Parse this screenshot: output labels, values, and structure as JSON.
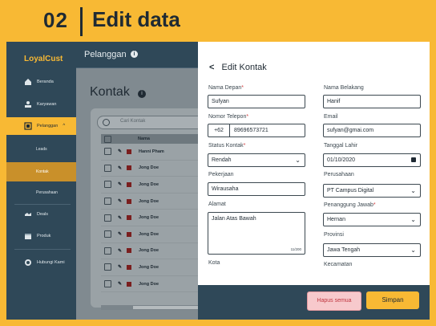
{
  "header": {
    "number": "02",
    "title": "Edit data"
  },
  "sidebar": {
    "logo": "LoyalCust",
    "items": [
      {
        "label": "Beranda"
      },
      {
        "label": "Karyawan"
      },
      {
        "label": "Pelanggan"
      },
      {
        "label": "Leads"
      },
      {
        "label": "Kontak"
      },
      {
        "label": "Perusahaan"
      },
      {
        "label": "Deals"
      },
      {
        "label": "Produk"
      },
      {
        "label": "Hubungi Kami"
      }
    ]
  },
  "page": {
    "breadcrumb": "Pelanggan",
    "title": "Kontak",
    "search_placeholder": "Cari Kontak",
    "table": {
      "header": "Nama",
      "rows": [
        "Hanni Pham",
        "Jong Doe",
        "Jong Doe",
        "Jong Doe",
        "Jong Doe",
        "Jong Doe",
        "Jong Doe",
        "Jong Doe",
        "Jong Doe"
      ]
    }
  },
  "drawer": {
    "title": "Edit Kontak",
    "fields": {
      "nama_depan": {
        "label": "Nama Depan",
        "value": "Sufyan"
      },
      "nama_belakang": {
        "label": "Nama Belakang",
        "value": "Hanif"
      },
      "nomor_telepon": {
        "label": "Nomor Telepon",
        "prefix": "+62",
        "value": "89696573721"
      },
      "email": {
        "label": "Email",
        "value": "sufyan@gmai.com"
      },
      "status_kontak": {
        "label": "Status Kontak",
        "value": "Rendah"
      },
      "tanggal_lahir": {
        "label": "Tanggal Lahir",
        "value": "01/10/2020"
      },
      "pekerjaan": {
        "label": "Pekerjaan",
        "value": "Wirausaha"
      },
      "perusahaan": {
        "label": "Perusahaan",
        "value": "PT Campus Digital"
      },
      "alamat": {
        "label": "Alamat",
        "value": "Jalan Atas Bawah",
        "counter": "11/200"
      },
      "penanggung_jawab": {
        "label": "Penanggung Jawab",
        "value": "Hernan"
      },
      "provinsi": {
        "label": "Provinsi",
        "value": "Jawa Tengah"
      },
      "kota": {
        "label": "Kota"
      },
      "kecamatan": {
        "label": "Kecamatan"
      }
    },
    "buttons": {
      "reset": "Hapus semua",
      "save": "Simpan"
    }
  }
}
